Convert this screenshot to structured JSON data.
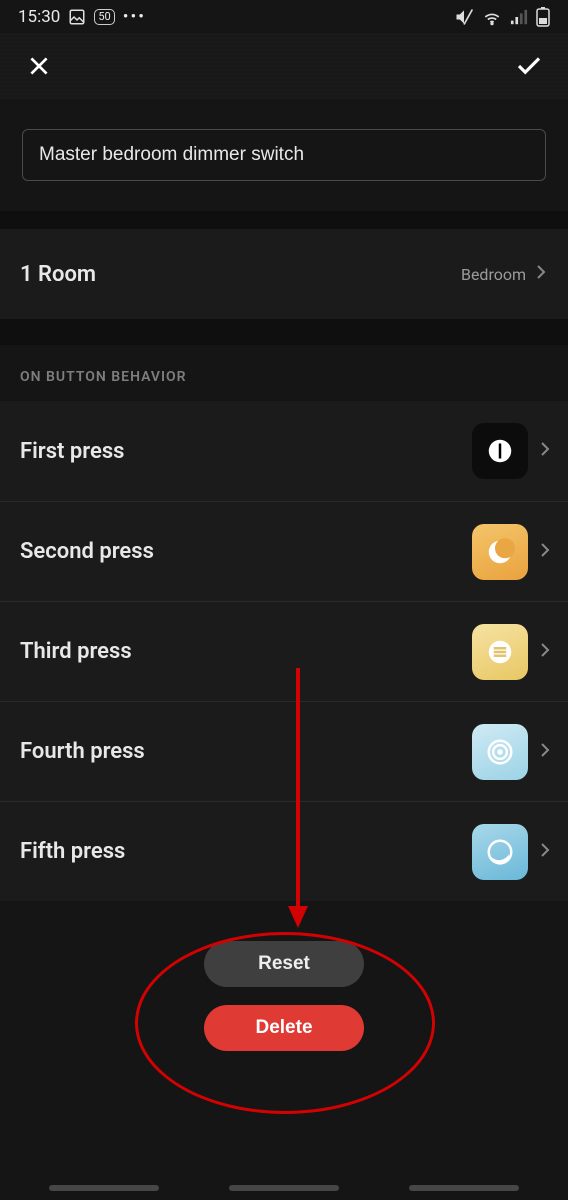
{
  "statusbar": {
    "time": "15:30",
    "nfc_badge": "50"
  },
  "editor": {
    "name": "Master bedroom dimmer switch"
  },
  "room": {
    "label": "1 Room",
    "value": "Bedroom"
  },
  "section": {
    "on_button_header": "ON BUTTON BEHAVIOR"
  },
  "presses": [
    {
      "label": "First press",
      "tile": "black",
      "icon": "power"
    },
    {
      "label": "Second press",
      "tile": "orange",
      "icon": "moon"
    },
    {
      "label": "Third press",
      "tile": "yellow",
      "icon": "lines"
    },
    {
      "label": "Fourth press",
      "tile": "blue1",
      "icon": "target"
    },
    {
      "label": "Fifth press",
      "tile": "blue2",
      "icon": "crescent"
    }
  ],
  "footer": {
    "reset": "Reset",
    "delete": "Delete"
  },
  "annotation": {
    "has_arrow": true,
    "has_ellipse": true
  }
}
